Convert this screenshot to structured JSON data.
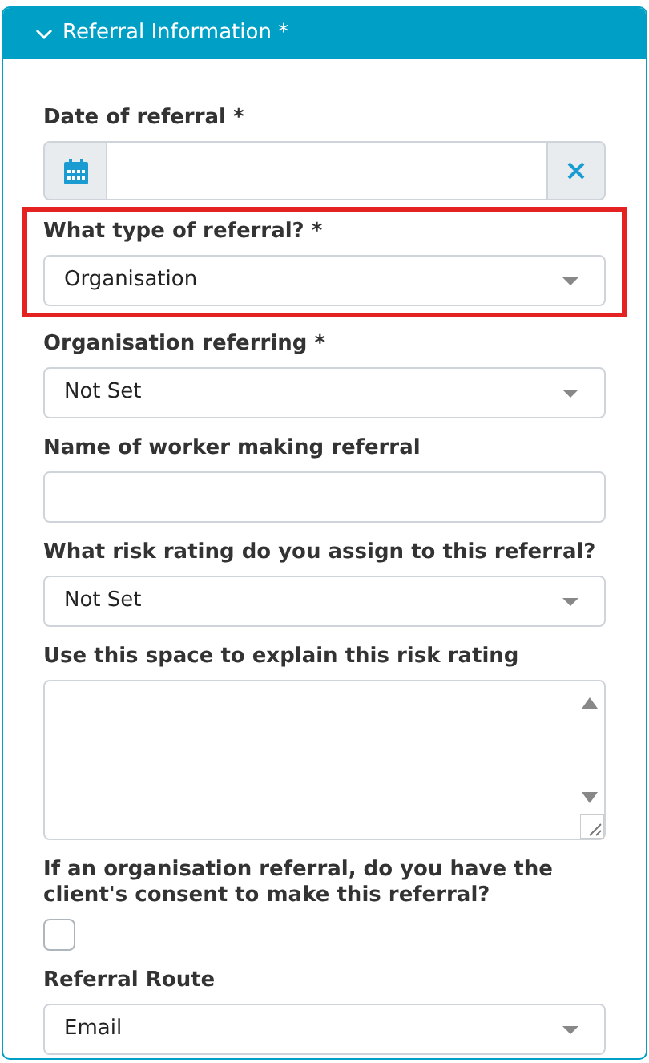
{
  "panel": {
    "title": "Referral Information *",
    "expanded": true
  },
  "fields": [
    {
      "kind": "date",
      "label": "Date of referral *",
      "highlighted": false
    },
    {
      "kind": "select",
      "label": "What type of referral? *",
      "value": "Organisation",
      "highlighted": true
    },
    {
      "kind": "select",
      "label": "Organisation referring *",
      "value": "Not Set",
      "highlighted": false
    },
    {
      "kind": "text",
      "label": "Name of worker making referral",
      "highlighted": false
    },
    {
      "kind": "select",
      "label": "What risk rating do you assign to this referral?",
      "value": "Not Set",
      "highlighted": false
    },
    {
      "kind": "textarea",
      "label": "Use this space to explain this risk rating",
      "highlighted": false
    },
    {
      "kind": "checkbox",
      "label": "If an organisation referral, do you have the client's consent to make this referral?",
      "checked": false,
      "highlighted": false
    },
    {
      "kind": "select",
      "label": "Referral Route",
      "value": "Email",
      "highlighted": false
    }
  ]
}
